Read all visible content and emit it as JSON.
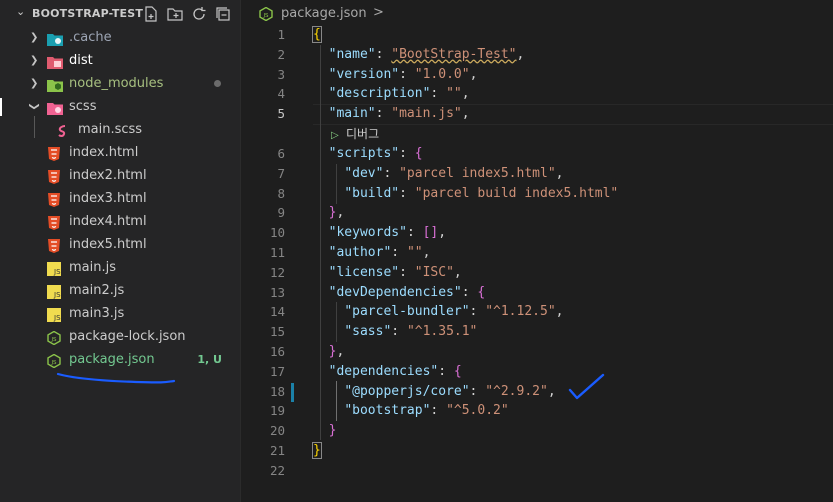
{
  "explorer": {
    "title": "BOOTSTRAP-TEST",
    "actions": [
      "new-file-icon",
      "new-folder-icon",
      "refresh-icon",
      "collapse-all-icon"
    ],
    "items": [
      {
        "label": ".cache",
        "kind": "folder",
        "icon": "folder-cache-icon",
        "color": "#9da5b4"
      },
      {
        "label": "dist",
        "kind": "folder",
        "icon": "folder-dist-icon",
        "color": "#ffffff"
      },
      {
        "label": "node_modules",
        "kind": "folder",
        "icon": "folder-node-icon",
        "color": "#a7c080"
      },
      {
        "label": "scss",
        "kind": "folder-open",
        "icon": "folder-sass-icon",
        "color": "#cccccc"
      },
      {
        "label": "main.scss",
        "kind": "file",
        "icon": "sass-icon",
        "color": "#cccccc"
      },
      {
        "label": "index.html",
        "kind": "file",
        "icon": "html5-icon",
        "color": "#cccccc"
      },
      {
        "label": "index2.html",
        "kind": "file",
        "icon": "html5-icon",
        "color": "#cccccc"
      },
      {
        "label": "index3.html",
        "kind": "file",
        "icon": "html5-icon",
        "color": "#cccccc"
      },
      {
        "label": "index4.html",
        "kind": "file",
        "icon": "html5-icon",
        "color": "#cccccc"
      },
      {
        "label": "index5.html",
        "kind": "file",
        "icon": "html5-icon",
        "color": "#cccccc"
      },
      {
        "label": "main.js",
        "kind": "file",
        "icon": "javascript-icon",
        "color": "#cccccc"
      },
      {
        "label": "main2.js",
        "kind": "file",
        "icon": "javascript-icon",
        "color": "#cccccc"
      },
      {
        "label": "main3.js",
        "kind": "file",
        "icon": "javascript-icon",
        "color": "#cccccc"
      },
      {
        "label": "package-lock.json",
        "kind": "file",
        "icon": "nodejs-icon",
        "color": "#cccccc"
      },
      {
        "label": "package.json",
        "kind": "file",
        "icon": "nodejs-icon",
        "color": "#73c991",
        "badge": "1, U"
      }
    ]
  },
  "editor": {
    "breadcrumb": {
      "file": "package.json",
      "separator": ">"
    },
    "codelens": "디버그",
    "line_numbers": [
      "1",
      "2",
      "3",
      "4",
      "5",
      "6",
      "7",
      "8",
      "9",
      "10",
      "11",
      "12",
      "13",
      "14",
      "15",
      "16",
      "17",
      "18",
      "19",
      "20",
      "21",
      "22"
    ],
    "code": {
      "name_key": "\"name\"",
      "name_val": "\"BootStrap-Test\"",
      "version_key": "\"version\"",
      "version_val": "\"1.0.0\"",
      "description_key": "\"description\"",
      "description_val": "\"\"",
      "main_key": "\"main\"",
      "main_val": "\"main.js\"",
      "scripts_key": "\"scripts\"",
      "dev_key": "\"dev\"",
      "dev_val": "\"parcel index5.html\"",
      "build_key": "\"build\"",
      "build_val": "\"parcel build index5.html\"",
      "keywords_key": "\"keywords\"",
      "author_key": "\"author\"",
      "author_val": "\"\"",
      "license_key": "\"license\"",
      "license_val": "\"ISC\"",
      "devdeps_key": "\"devDependencies\"",
      "parcel_key": "\"parcel-bundler\"",
      "parcel_val": "\"^1.12.5\"",
      "sass_key": "\"sass\"",
      "sass_val": "\"^1.35.1\"",
      "deps_key": "\"dependencies\"",
      "popper_key": "\"@popperjs/core\"",
      "popper_val": "\"^2.9.2\"",
      "bootstrap_key": "\"bootstrap\"",
      "bootstrap_val": "\"^5.0.2\""
    }
  },
  "colors": {
    "key": "#9cdcfe",
    "string": "#ce9178",
    "brace_gold": "#ffd700",
    "brace_purple": "#da70d6",
    "annotation": "#1a5cff",
    "badge_green": "#73c991"
  }
}
